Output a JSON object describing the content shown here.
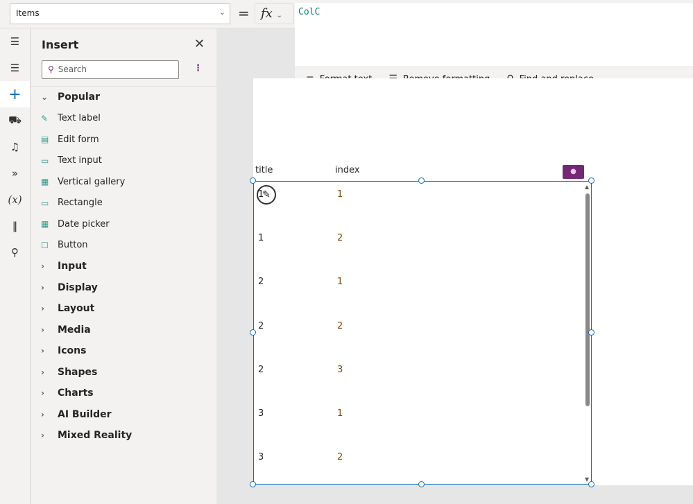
{
  "property": {
    "value": "Items"
  },
  "formula": {
    "equals": "=",
    "fx": "fx",
    "value": "ColC"
  },
  "formula_toolbar": [
    "Format text",
    "Remove formatting",
    "Find and replace"
  ],
  "insert_panel": {
    "title": "Insert",
    "search_placeholder": "Search",
    "items": [
      {
        "label": "Popular",
        "type": "category",
        "expanded": true
      },
      {
        "label": "Text label",
        "type": "item",
        "icon": "text-label-icon"
      },
      {
        "label": "Edit form",
        "type": "item",
        "icon": "edit-form-icon"
      },
      {
        "label": "Text input",
        "type": "item",
        "icon": "text-input-icon"
      },
      {
        "label": "Vertical gallery",
        "type": "item",
        "icon": "gallery-icon"
      },
      {
        "label": "Rectangle",
        "type": "item",
        "icon": "rectangle-icon"
      },
      {
        "label": "Date picker",
        "type": "item",
        "icon": "calendar-icon"
      },
      {
        "label": "Button",
        "type": "item",
        "icon": "button-icon"
      },
      {
        "label": "Input",
        "type": "category"
      },
      {
        "label": "Display",
        "type": "category"
      },
      {
        "label": "Layout",
        "type": "category"
      },
      {
        "label": "Media",
        "type": "category"
      },
      {
        "label": "Icons",
        "type": "category"
      },
      {
        "label": "Shapes",
        "type": "category"
      },
      {
        "label": "Charts",
        "type": "category"
      },
      {
        "label": "AI Builder",
        "type": "category"
      },
      {
        "label": "Mixed Reality",
        "type": "category"
      }
    ]
  },
  "gallery": {
    "headers": [
      "title",
      "index"
    ],
    "rows": [
      [
        "1",
        "1"
      ],
      [
        "1",
        "2"
      ],
      [
        "2",
        "1"
      ],
      [
        "2",
        "2"
      ],
      [
        "2",
        "3"
      ],
      [
        "3",
        "1"
      ],
      [
        "3",
        "2"
      ]
    ]
  },
  "colors": {
    "accent": "#742774",
    "selection": "#0f6cbd"
  }
}
